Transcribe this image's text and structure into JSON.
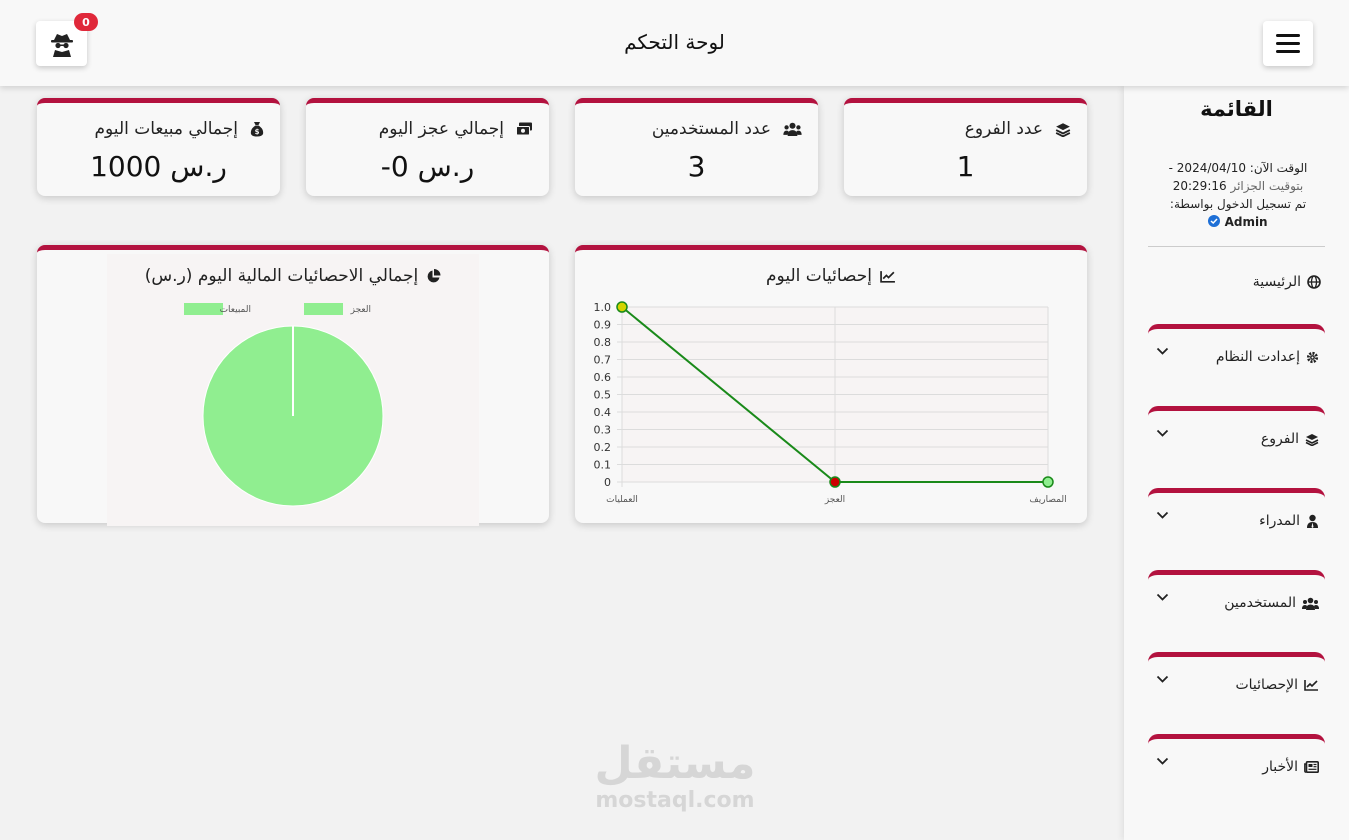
{
  "header": {
    "title": "لوحة التحكم",
    "notification_count": "0"
  },
  "sidebar": {
    "title": "القائمة",
    "time_line1": "الوقت الآن: 2024/04/10 -",
    "time_line2_time": "20:29:16",
    "time_line2_zone": "بتوقيت الجزائر",
    "login_label": "تم تسجيل الدخول بواسطة:",
    "user": "Admin",
    "home": "الرئيسية",
    "groups": [
      {
        "label": "إعدادت النظام",
        "icon": "gear-icon"
      },
      {
        "label": "الفروع",
        "icon": "layers-icon"
      },
      {
        "label": "المدراء",
        "icon": "user-tie-icon"
      },
      {
        "label": "المستخدمين",
        "icon": "users-icon"
      },
      {
        "label": "الإحصائيات",
        "icon": "chart-line-icon"
      },
      {
        "label": "الأخبار",
        "icon": "newspaper-icon"
      }
    ]
  },
  "stats": [
    {
      "label": "عدد الفروع",
      "value": "1",
      "icon": "layers-icon"
    },
    {
      "label": "عدد المستخدمين",
      "value": "3",
      "icon": "users-icon"
    },
    {
      "label": "إجمالي عجز اليوم",
      "value": "-0 ر.س",
      "icon": "money-icon"
    },
    {
      "label": "إجمالي مبيعات اليوم",
      "value": "1000 ر.س",
      "icon": "money-bag-icon"
    }
  ],
  "charts": {
    "line_title": "إحصائيات اليوم",
    "pie_title": "إجمالي الاحصائيات المالية اليوم (ر.س)"
  },
  "chart_data": [
    {
      "type": "line",
      "title": "إحصائيات اليوم",
      "categories": [
        "العمليات",
        "العجز",
        "المصاريف"
      ],
      "series": [
        {
          "values": [
            1,
            0,
            0
          ]
        }
      ],
      "ylim": [
        0,
        1
      ],
      "yticks": [
        "1.0",
        "0.9",
        "0.8",
        "0.7",
        "0.6",
        "0.5",
        "0.4",
        "0.3",
        "0.2",
        "0.1",
        "0"
      ],
      "point_colors": [
        "#d4d400",
        "#cc0000",
        "#90ee90"
      ],
      "line_color": "#1a8a1a",
      "grid": true
    },
    {
      "type": "pie",
      "title": "إجمالي الاحصائيات المالية اليوم (ر.س)",
      "legend": [
        "العجز",
        "المبيعات"
      ],
      "values": [
        0,
        1000
      ],
      "colors": [
        "#90ee90",
        "#90ee90"
      ]
    }
  ],
  "watermark": {
    "ar": "مستقل",
    "en": "mostaql.com"
  }
}
